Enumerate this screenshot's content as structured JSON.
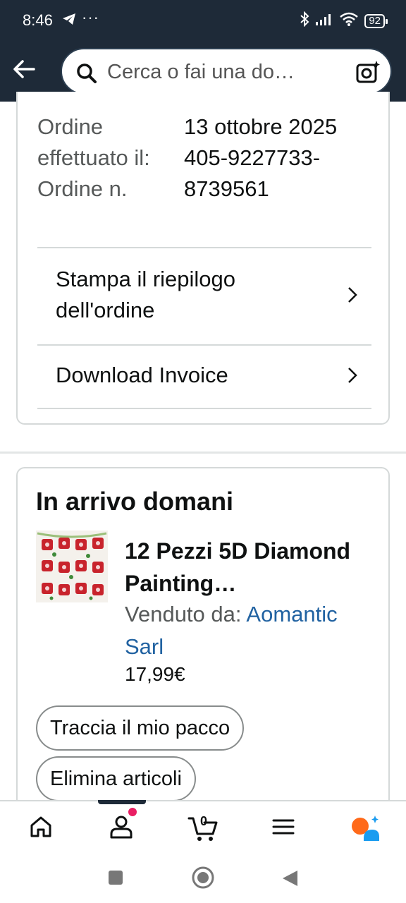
{
  "status_bar": {
    "time": "8:46",
    "dots": "···",
    "battery": "92"
  },
  "search": {
    "placeholder": "Cerca o fai una do…"
  },
  "order_info": {
    "labels": "Ordine effettuato il: Ordine n.",
    "date": "13 ottobre 2025",
    "order_number": "405-9227733-8739561"
  },
  "actions": {
    "print_summary": "Stampa il riepilogo dell'ordine",
    "download_invoice": "Download Invoice"
  },
  "shipment": {
    "heading": "In arrivo domani",
    "product_title": "12 Pezzi 5D Diamond Painting…",
    "seller_label": "Venduto da:",
    "seller_name": "Aomantic Sarl",
    "price": "17,99€",
    "track_button": "Traccia il mio pacco",
    "delete_button": "Elimina articoli"
  },
  "bottom_nav": {
    "cart_count": "0"
  },
  "colors": {
    "header": "#1e2a38",
    "link": "#2162a1",
    "badge": "#e91e63",
    "assistant_orange": "#ff6a1a",
    "assistant_blue": "#1a9cf0"
  }
}
